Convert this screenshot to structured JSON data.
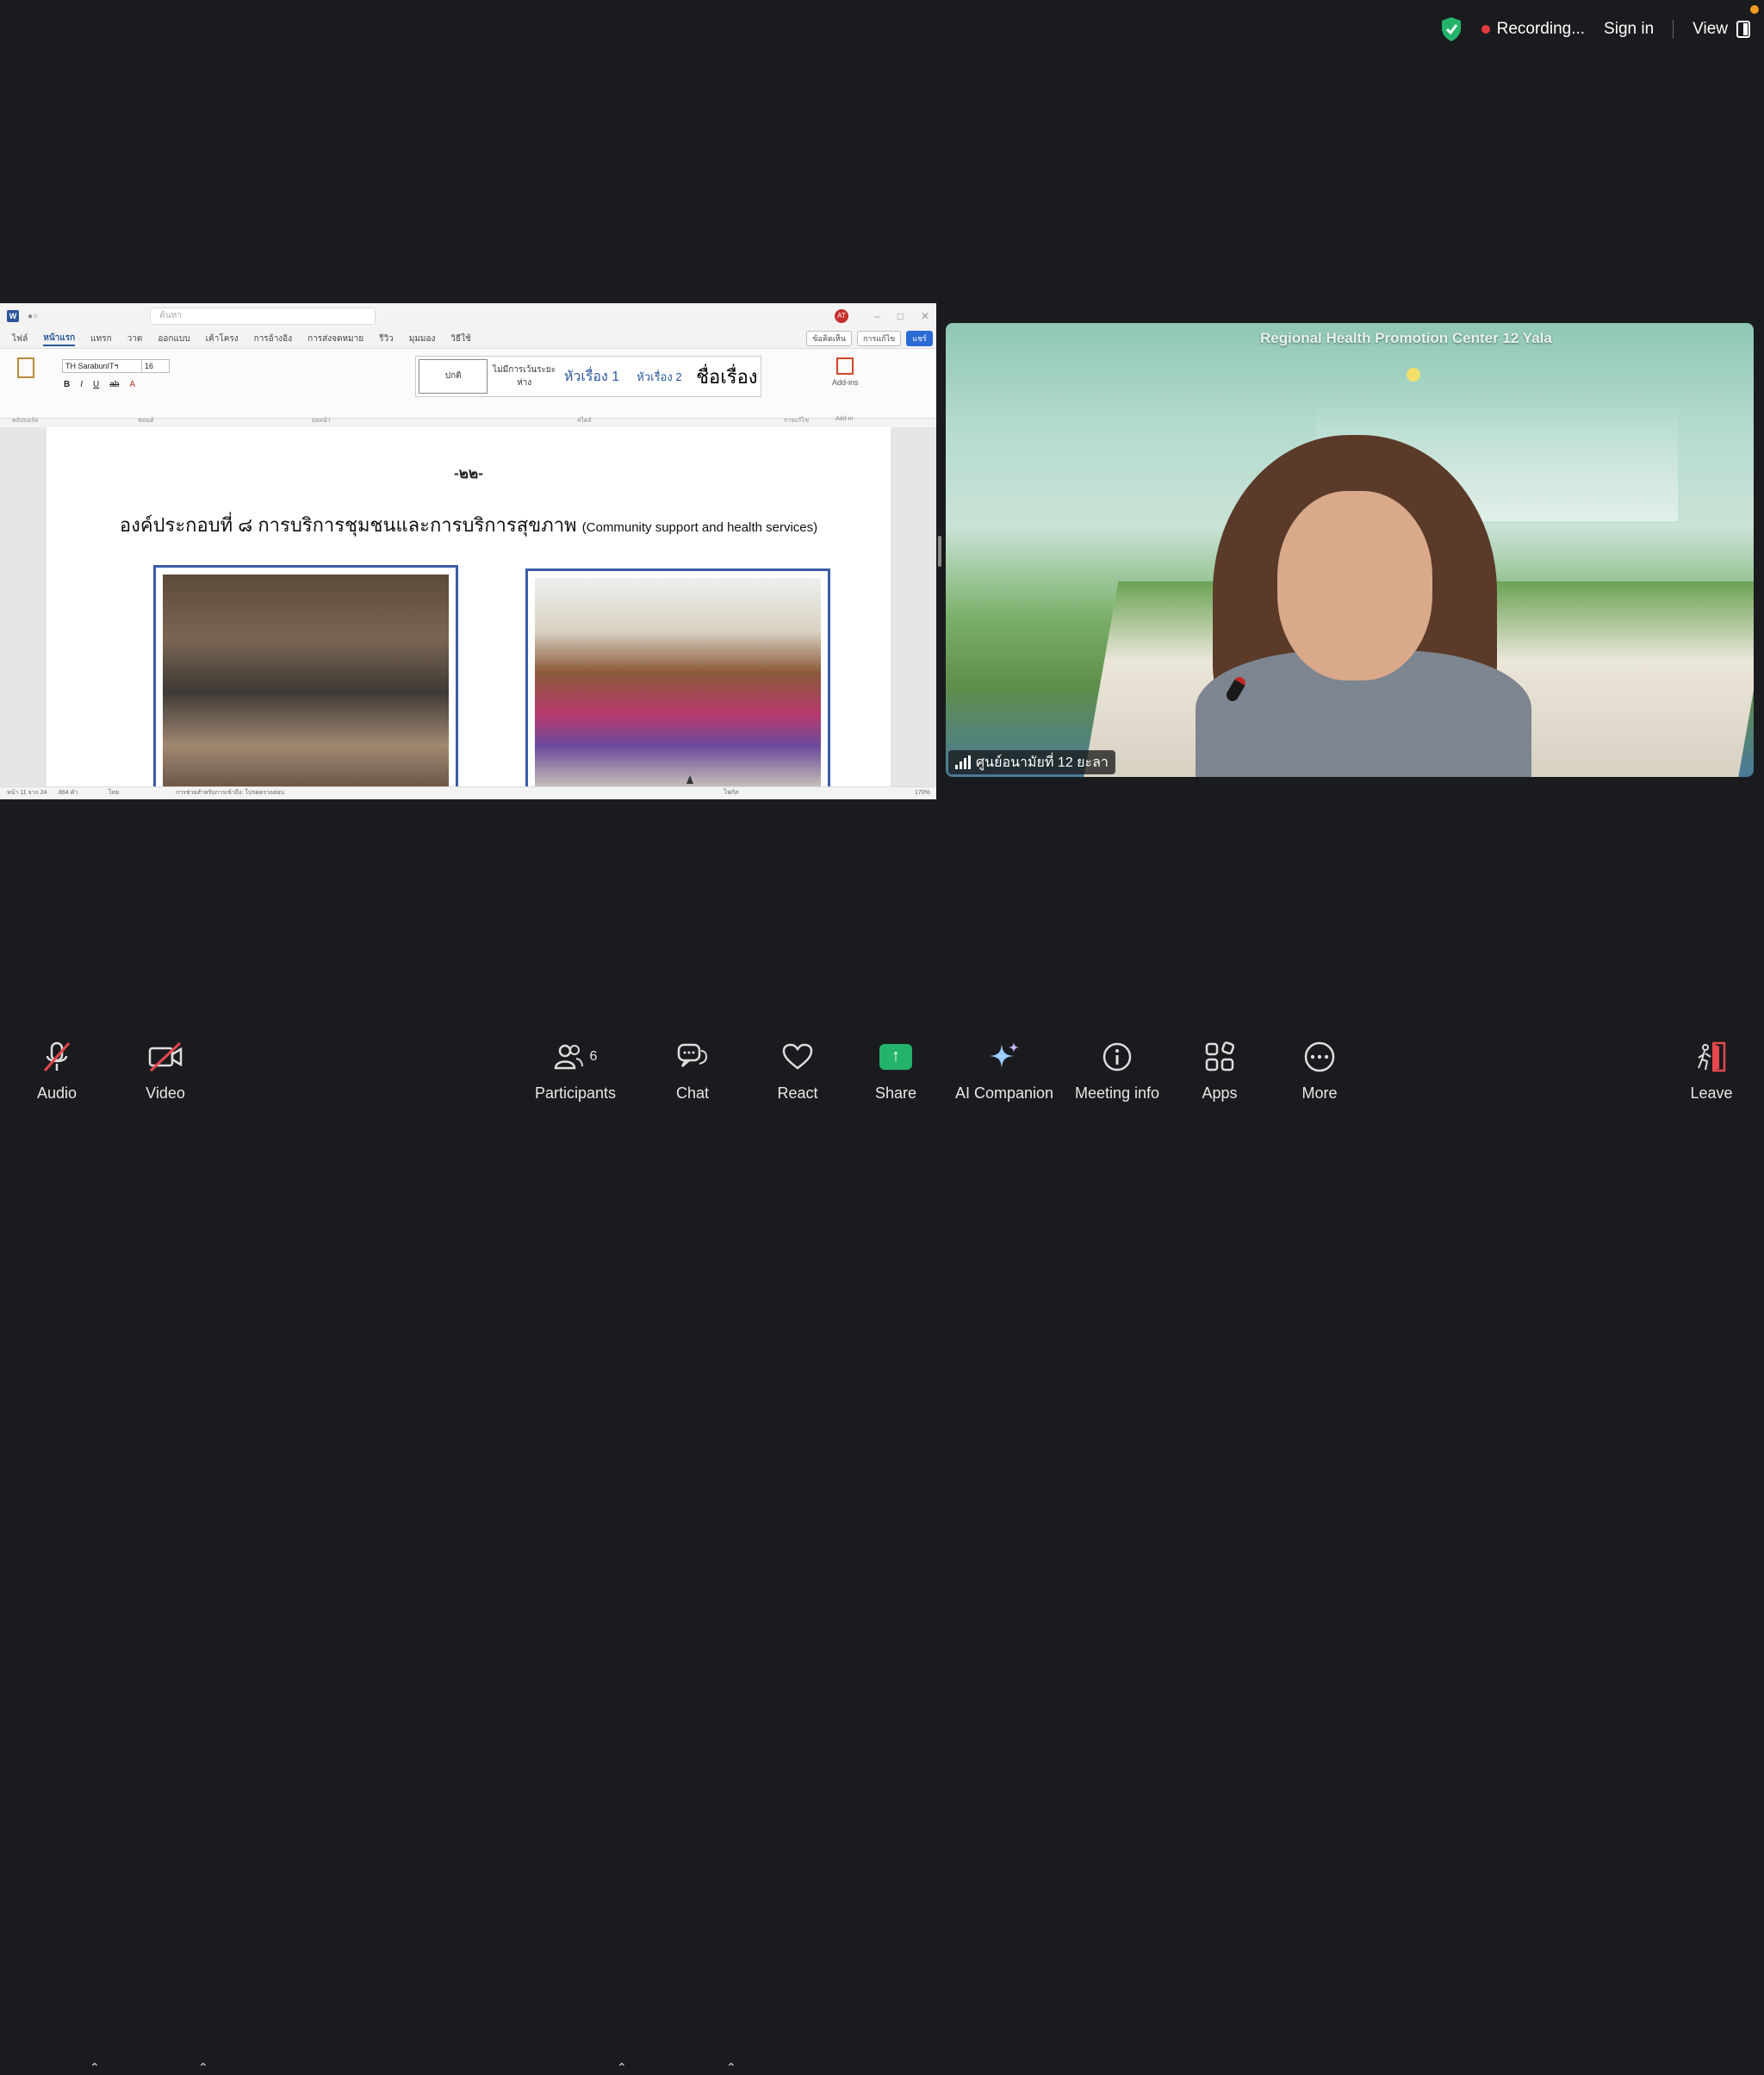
{
  "topbar": {
    "recording_label": "Recording...",
    "sign_in_label": "Sign in",
    "view_label": "View"
  },
  "word": {
    "search_placeholder": "ค้นหา",
    "avatar_initials": "AT",
    "tabs": [
      "ไฟล์",
      "หน้าแรก",
      "แทรก",
      "วาด",
      "ออกแบบ",
      "เค้าโครง",
      "การอ้างอิง",
      "การส่งจดหมาย",
      "รีวิว",
      "มุมมอง",
      "วิธีใช้"
    ],
    "comments_label": "ข้อคิดเห็น",
    "editing_label": "การแก้ไข",
    "share_label": "แชร์",
    "font_name": "TH SarabunITฯ",
    "font_size": "16",
    "styles": [
      "ปกติ",
      "ไม่มีการเว้นระยะห่าง",
      "หัวเรื่อง 1",
      "หัวเรื่อง 2",
      "ชื่อเรื่อง"
    ],
    "addins_label": "Add-ins",
    "group_labels": [
      "คลิปบอร์ด",
      "ฟอนต์",
      "ย่อหน้า",
      "สไตล์",
      "การแก้ไข",
      "Add-in"
    ],
    "page_number": "-๒๒-",
    "heading_th": "องค์ประกอบที่ ๘ การบริการชุมชนและการบริการสุขภาพ",
    "heading_en": "(Community support and health services)",
    "status_page": "หน้า 11 จาก 24",
    "status_words": "864 คำ",
    "status_lang": "ไทย",
    "status_accessibility": "การช่วยสำหรับการเข้าถึง: โปรดตรวจสอบ",
    "status_focus": "โฟกัส",
    "zoom": "170%"
  },
  "video": {
    "banner_text": "Regional Health Promotion Center 12 Yala",
    "participant_name": "ศูนย์อนามัยที่ 12 ยะลา"
  },
  "toolbar": {
    "audio": "Audio",
    "video": "Video",
    "participants": "Participants",
    "participants_count": "6",
    "chat": "Chat",
    "react": "React",
    "share": "Share",
    "ai_companion": "AI Companion",
    "meeting_info": "Meeting info",
    "apps": "Apps",
    "more": "More",
    "leave": "Leave"
  },
  "colors": {
    "background": "#1a1b1e",
    "recording": "#e23b3b",
    "share_green": "#24b36b",
    "leave_red": "#e5484d",
    "word_blue": "#2b579a"
  }
}
